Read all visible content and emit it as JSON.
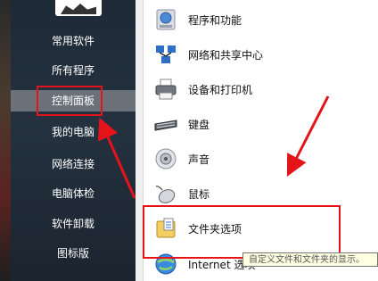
{
  "sidebar": {
    "items": [
      {
        "label": "常用软件"
      },
      {
        "label": "所有程序"
      },
      {
        "label": "控制面板"
      },
      {
        "label": "我的电脑"
      },
      {
        "label": "网络连接"
      },
      {
        "label": "电脑体检"
      },
      {
        "label": "软件卸载"
      },
      {
        "label": "图标版"
      }
    ],
    "selected_index": 2
  },
  "control_panel": {
    "items": [
      {
        "label": "程序和功能",
        "icon": "programs-features-icon"
      },
      {
        "label": "网络和共享中心",
        "icon": "network-sharing-icon"
      },
      {
        "label": "设备和打印机",
        "icon": "printer-icon"
      },
      {
        "label": "键盘",
        "icon": "keyboard-icon"
      },
      {
        "label": "声音",
        "icon": "speaker-icon"
      },
      {
        "label": "鼠标",
        "icon": "mouse-icon"
      },
      {
        "label": "文件夹选项",
        "icon": "folder-options-icon"
      },
      {
        "label": "Internet 选项",
        "icon": "internet-options-icon"
      }
    ]
  },
  "tooltip": {
    "text": "自定义文件和文件夹的显示。"
  },
  "colors": {
    "highlight_red": "#e4141a",
    "sidebar_bg": "#24313f",
    "selected_bg": "#6b7178"
  }
}
